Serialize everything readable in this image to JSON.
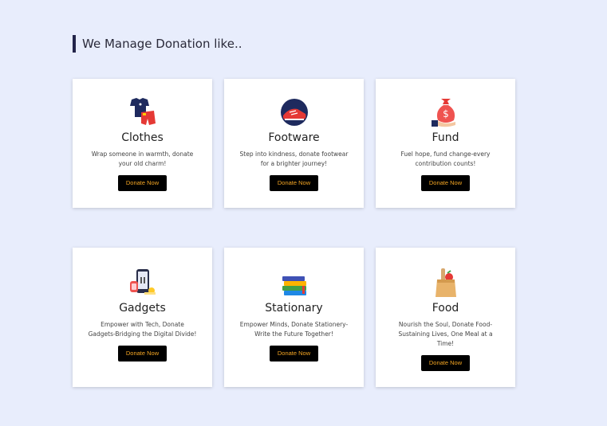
{
  "section": {
    "title": "We Manage Donation like.."
  },
  "cards": [
    {
      "title": "Clothes",
      "desc": "Wrap someone in warmth, donate your old charm!",
      "button": "Donate Now",
      "icon": "clothes-icon"
    },
    {
      "title": "Footware",
      "desc": "Step into kindness, donate footwear for a brighter journey!",
      "button": "Donate Now",
      "icon": "shoe-icon"
    },
    {
      "title": "Fund",
      "desc": "Fuel hope, fund change-every contribution counts!",
      "button": "Donate Now",
      "icon": "money-bag-icon"
    },
    {
      "title": "Gadgets",
      "desc": "Empower with Tech, Donate Gadgets-Bridging the Digital Divide!",
      "button": "Donate Now",
      "icon": "gadgets-icon"
    },
    {
      "title": "Stationary",
      "desc": "Empower Minds, Donate Stationery-Write the Future Together!",
      "button": "Donate Now",
      "icon": "books-icon"
    },
    {
      "title": "Food",
      "desc": "Nourish the Soul, Donate Food-Sustaining Lives, One Meal at a Time!",
      "button": "Donate Now",
      "icon": "grocery-bag-icon"
    }
  ],
  "colors": {
    "background": "#e8edfc",
    "button_bg": "#000000",
    "button_text": "#f5a623",
    "accent_bar": "#23244a"
  }
}
